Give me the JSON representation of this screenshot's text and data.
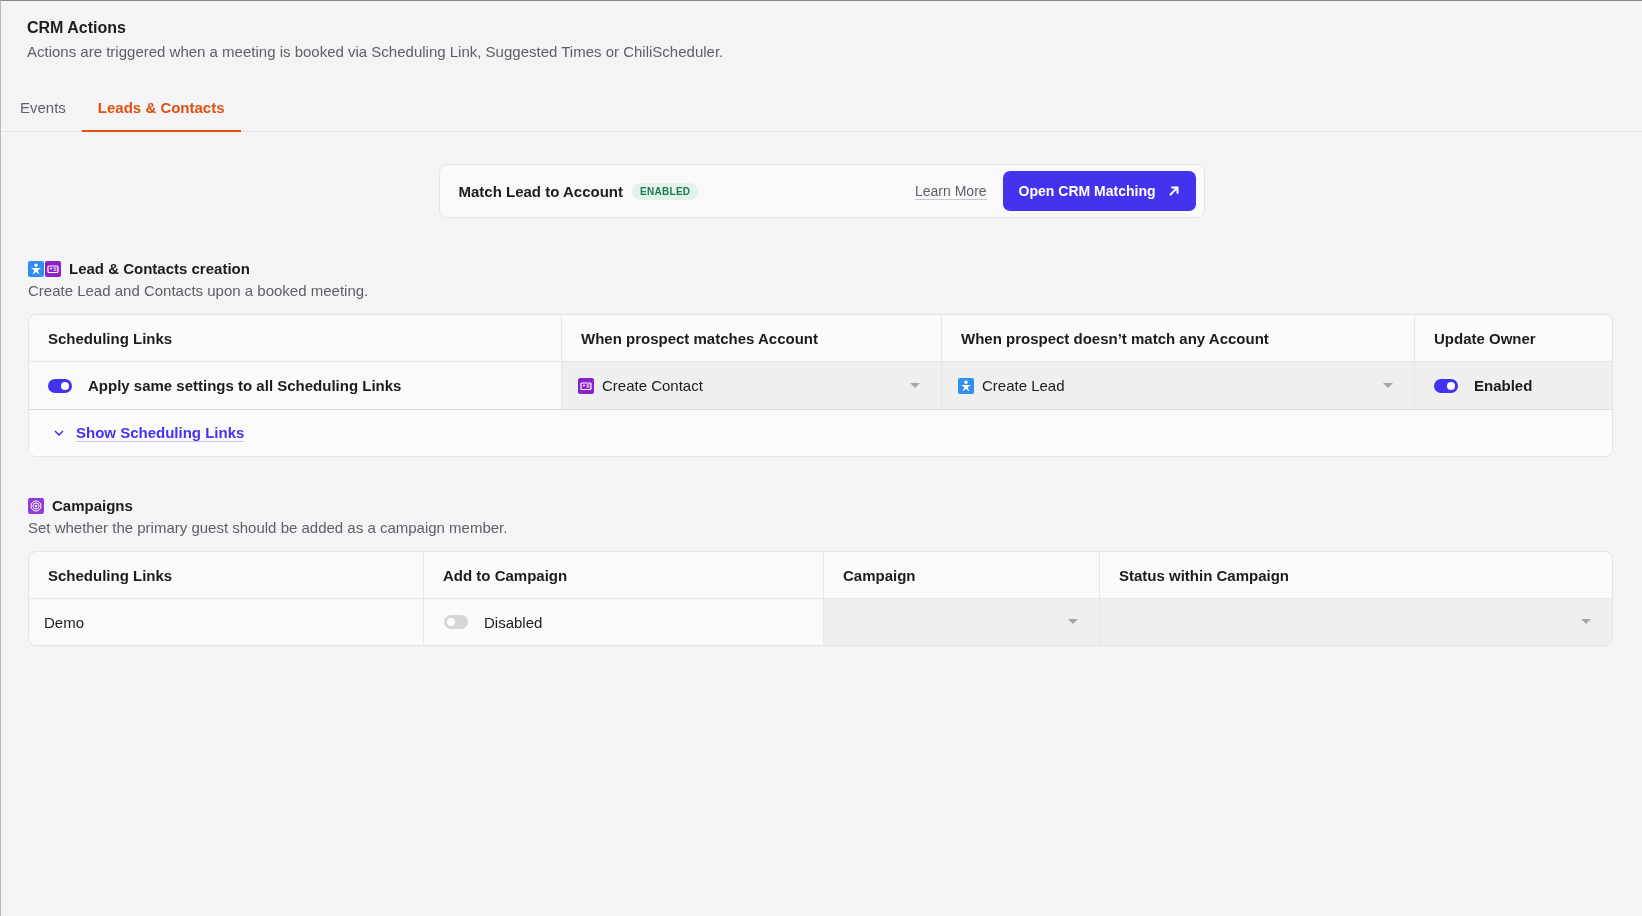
{
  "header": {
    "title": "CRM Actions",
    "subtitle": "Actions are triggered when a meeting is booked via Scheduling Link, Suggested Times or ChiliScheduler."
  },
  "tabs": [
    {
      "label": "Events",
      "selected": false
    },
    {
      "label": "Leads & Contacts",
      "selected": true
    }
  ],
  "match_card": {
    "label": "Match Lead to Account",
    "badge": "ENABLED",
    "link": "Learn More",
    "button": "Open CRM Matching"
  },
  "sections": [
    {
      "kind": "leads",
      "title": "Lead & Contacts creation",
      "description": "Create Lead and Contacts upon a booked meeting.",
      "columns": [
        "Scheduling Links",
        "When prospect matches Account",
        "When prospect doesn’t match any Account",
        "Update Owner"
      ],
      "rows": [
        {
          "cells": [
            {
              "kind": "toggle",
              "on": true,
              "label": "Apply same settings to all Scheduling Links"
            },
            {
              "kind": "contact-select",
              "value": "Create Contact"
            },
            {
              "kind": "lead-select",
              "value": "Create Lead"
            },
            {
              "kind": "toggle",
              "on": true,
              "label": "Enabled"
            }
          ]
        }
      ],
      "footer": {
        "label": "Show Scheduling Links",
        "expanded": false
      }
    },
    {
      "kind": "campaigns",
      "title": "Campaigns",
      "description": "Set whether the primary guest should be added as a campaign member.",
      "columns": [
        "Scheduling Links",
        "Add to Campaign",
        "Campaign",
        "Status within Campaign"
      ],
      "rows": [
        {
          "cells": [
            {
              "kind": "text",
              "value": "Demo"
            },
            {
              "kind": "toggle",
              "on": false,
              "label": "Disabled"
            },
            {
              "kind": "select"
            },
            {
              "kind": "select"
            }
          ]
        }
      ]
    }
  ]
}
